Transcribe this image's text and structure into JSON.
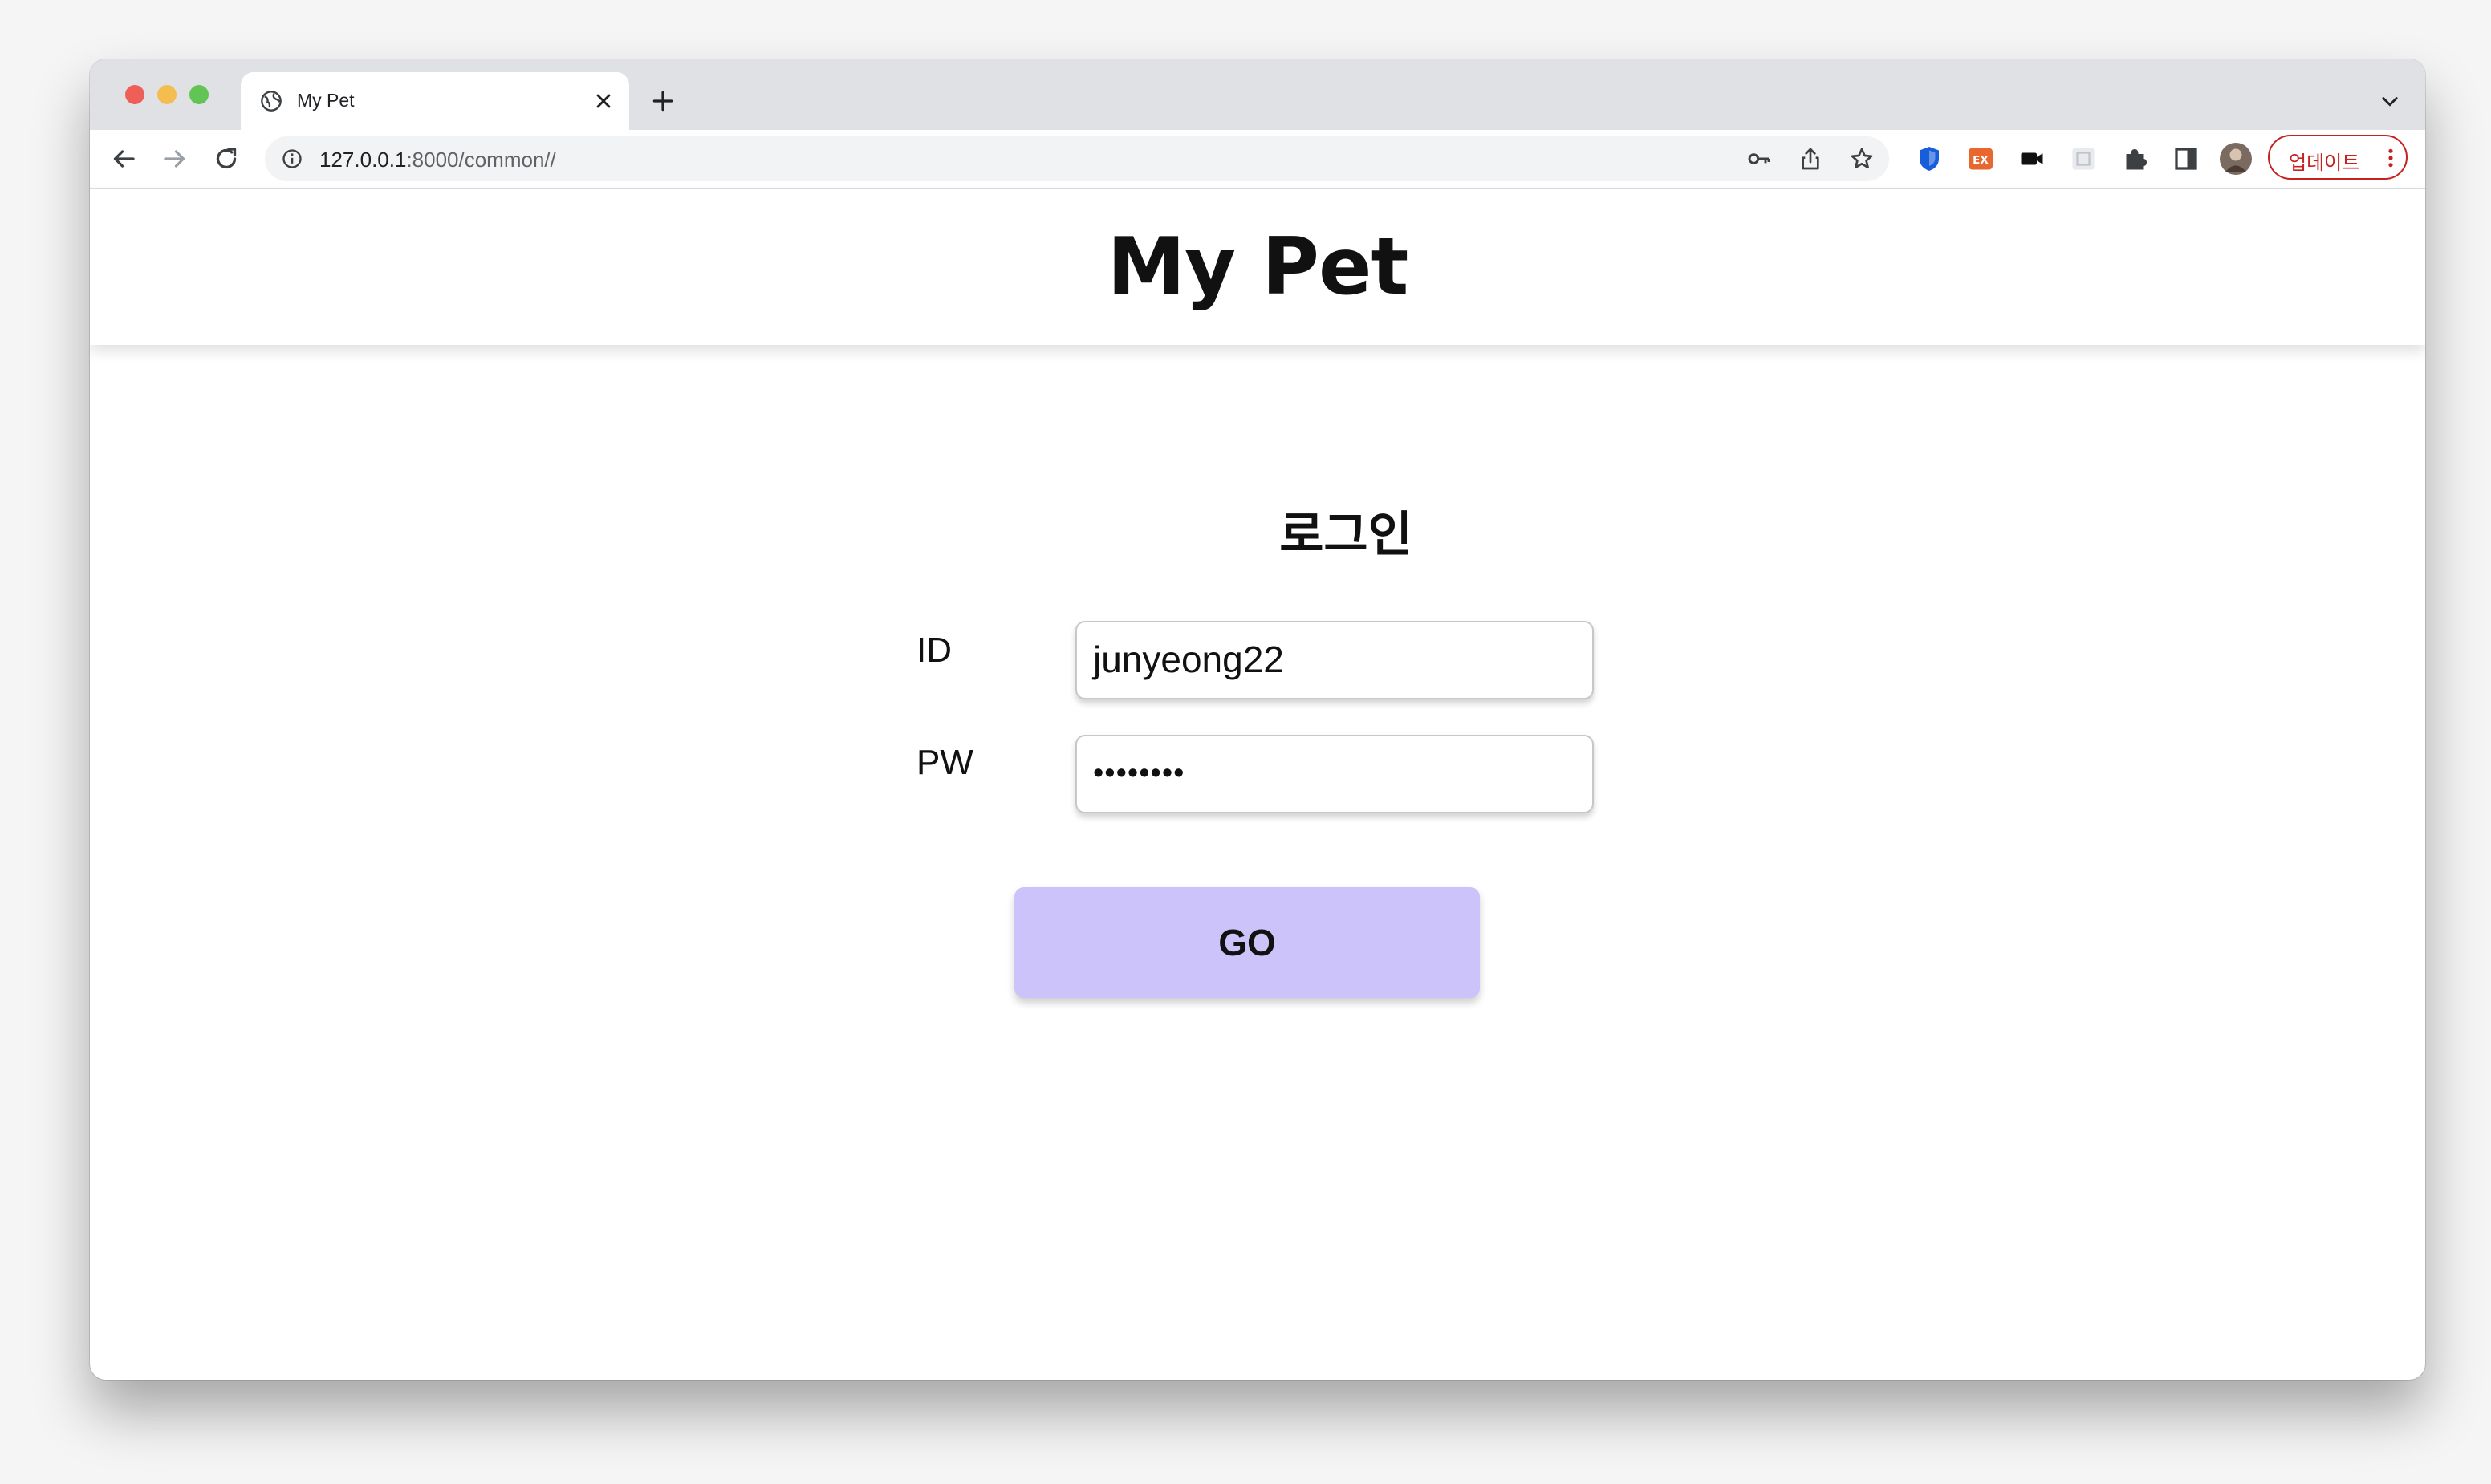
{
  "browser": {
    "tab_title": "My Pet",
    "url_host": "127.0.0.1",
    "url_rest": ":8000/common//",
    "update_label": "업데이트",
    "icons": [
      "globe-icon",
      "close-icon",
      "plus-icon",
      "chevron-down-icon",
      "back-arrow-icon",
      "forward-arrow-icon",
      "reload-icon",
      "info-icon",
      "key-icon",
      "share-icon",
      "star-icon",
      "bitwarden-shield-icon",
      "ex-extension-icon",
      "video-camera-icon",
      "grid-extension-icon",
      "puzzle-icon",
      "side-panel-icon",
      "avatar",
      "more-vert-icon"
    ]
  },
  "page": {
    "site_title": "My Pet",
    "login_heading": "로그인",
    "id_label": "ID",
    "id_value": "junyeong22",
    "pw_label": "PW",
    "pw_value": "••••••••",
    "submit_label": "GO"
  },
  "colors": {
    "button_bg": "#ccc3fa",
    "update_red": "#c5221f",
    "tabstrip_bg": "#dfe1e5"
  }
}
